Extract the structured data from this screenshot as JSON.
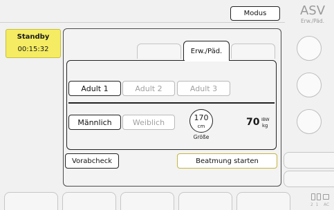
{
  "header": {
    "mode_button_label": "Modus",
    "mode_title": "ASV",
    "mode_subtitle": "Erw./Päd."
  },
  "status": {
    "state_label": "Standby",
    "timer": "00:15:32",
    "accent_color": "#f5ec63"
  },
  "tabs": [
    {
      "label": ""
    },
    {
      "label": "Erw./Päd."
    },
    {
      "label": ""
    }
  ],
  "patient_groups": [
    {
      "label": "Adult 1",
      "selected": true
    },
    {
      "label": "Adult 2",
      "selected": false
    },
    {
      "label": "Adult 3",
      "selected": false
    }
  ],
  "gender": [
    {
      "label": "Männlich",
      "selected": true
    },
    {
      "label": "Weiblich",
      "selected": false
    }
  ],
  "height": {
    "value": "170",
    "unit": "cm",
    "label": "Größe"
  },
  "ibw": {
    "value": "70",
    "label": "IBW",
    "unit": "kg"
  },
  "actions": {
    "precheck_label": "Vorabcheck",
    "start_label": "Beatmung starten"
  },
  "corner_indicator": {
    "digits": "2  1",
    "ac": "AC"
  }
}
